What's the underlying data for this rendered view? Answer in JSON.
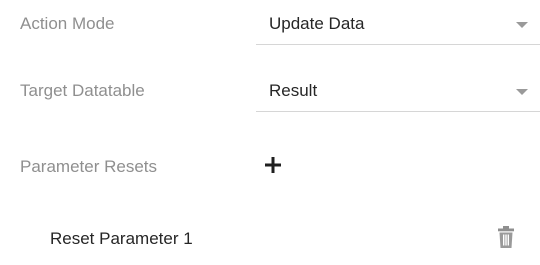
{
  "action_mode": {
    "label": "Action Mode",
    "value": "Update Data",
    "icon": "chevron-down-icon"
  },
  "target_datatable": {
    "label": "Target Datatable",
    "value": "Result",
    "icon": "chevron-down-icon"
  },
  "parameter_resets": {
    "label": "Parameter Resets",
    "add_icon": "plus-icon",
    "items": [
      {
        "label": "Reset Parameter 1",
        "delete_icon": "trash-icon"
      }
    ]
  },
  "colors": {
    "label": "#8f8f8f",
    "value": "#262626",
    "underline": "#d6d6d6",
    "icon": "#9a9a9a"
  }
}
